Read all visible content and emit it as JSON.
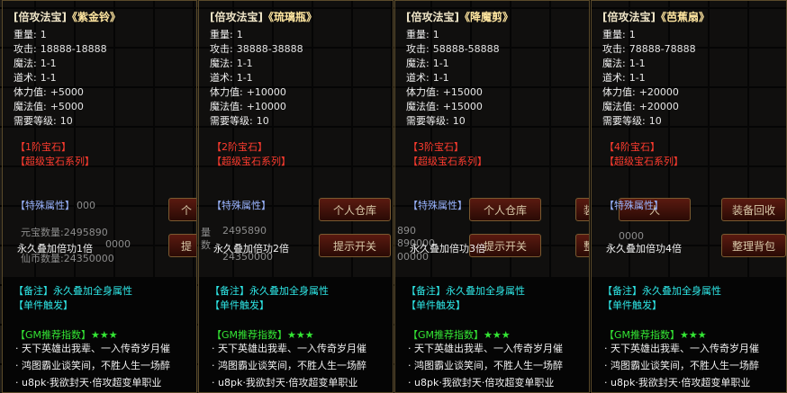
{
  "labels": {
    "weight": "重量:",
    "attack": "攻击:",
    "magic": "魔法:",
    "tao": "道术:",
    "hp": "体力值:",
    "mp": "魔法值:",
    "level": "需要等级:"
  },
  "panels": [
    {
      "tag": "[倍攻法宝]",
      "name": "《紫金铃》",
      "weight": "1",
      "attack": "18888-18888",
      "magic": "1-1",
      "tao": "1-1",
      "hp": "+5000",
      "mp": "+5000",
      "level": "10",
      "gem_tier": "【1阶宝石】",
      "gem_series": "【超级宝石系列】",
      "special": "【特殊属性】",
      "perm": "永久叠加倍功1倍"
    },
    {
      "tag": "[倍攻法宝]",
      "name": "《琉璃瓶》",
      "weight": "1",
      "attack": "38888-38888",
      "magic": "1-1",
      "tao": "1-1",
      "hp": "+10000",
      "mp": "+10000",
      "level": "10",
      "gem_tier": "【2阶宝石】",
      "gem_series": "【超级宝石系列】",
      "special": "【特殊属性】",
      "perm": "永久叠加倍功2倍"
    },
    {
      "tag": "[倍攻法宝]",
      "name": "《降魔剪》",
      "weight": "1",
      "attack": "58888-58888",
      "magic": "1-1",
      "tao": "1-1",
      "hp": "+15000",
      "mp": "+15000",
      "level": "10",
      "gem_tier": "【3阶宝石】",
      "gem_series": "【超级宝石系列】",
      "special": "【特殊属性】",
      "perm": "永久叠加倍功3倍"
    },
    {
      "tag": "[倍攻法宝]",
      "name": "《芭蕉扇》",
      "weight": "1",
      "attack": "78888-78888",
      "magic": "1-1",
      "tao": "1-1",
      "hp": "+20000",
      "mp": "+20000",
      "level": "10",
      "gem_tier": "【4阶宝石】",
      "gem_series": "【超级宝石系列】",
      "special": "【特殊属性】",
      "perm": "永久叠加倍功4倍"
    }
  ],
  "footer": {
    "note": "【备注】永久叠加全身属性",
    "trigger": "【单件触发】",
    "gm_label": "【GM推荐指数】",
    "stars": "★★★",
    "line1": "天下英雄出我辈、一入传奇岁月催",
    "line2": "鸿图霸业谈笑间，不胜人生一场醉",
    "line3": "u8pk·我欲封天·倍攻超变单职业"
  },
  "background_ui": {
    "personal_warehouse": "个人仓库",
    "hint_switch": "提示开关",
    "equip_recycle": "装备回收",
    "organize_bag": "整理背包",
    "yuanbao_label": "元宝数量:",
    "yuanbao_value": "2495890",
    "xianbi_label": "仙币数量:",
    "xianbi_value": "24350000",
    "partial_amount": "000",
    "partial_amount2": "0000",
    "partial_digits_a": "890",
    "partial_digits_b": "890000",
    "partial_digits_c": "00000",
    "partial_digits_d": "0000",
    "fragment_ge": "个",
    "fragment_ti": "提",
    "fragment_zhuang": "装",
    "fragment_ren": "人",
    "fragment_zheng": "整",
    "fragment_liang": "量",
    "fragment_shu": "数"
  }
}
